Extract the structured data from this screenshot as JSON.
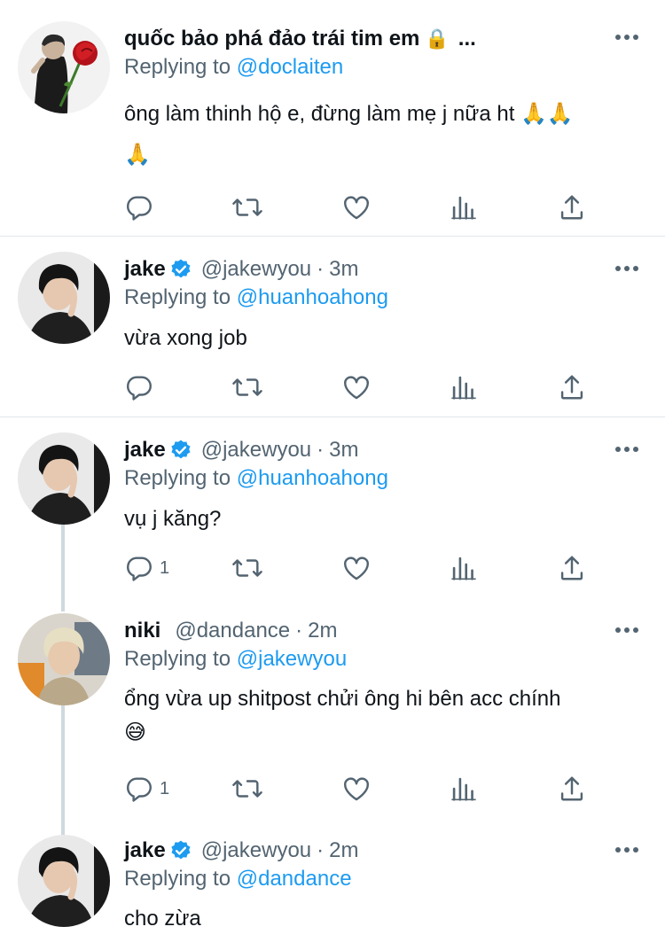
{
  "tweets": [
    {
      "name": "quốc bảo phá đảo trái tim em",
      "lock": "🔒",
      "ellipsis": "...",
      "handle": "",
      "time": "",
      "replying_prefix": "Replying to",
      "replying_to": "@doclaiten",
      "text_line1": "ông làm thinh hộ e, đừng làm mẹ j nữa ht 🙏🙏",
      "text_line2": "🙏",
      "reply_count": "",
      "verified": false
    },
    {
      "name": "jake",
      "handle": "@jakewyou",
      "dot": "·",
      "time": "3m",
      "replying_prefix": "Replying to",
      "replying_to": "@huanhoahong",
      "text_line1": "vừa xong job",
      "reply_count": "",
      "verified": true
    },
    {
      "name": "jake",
      "handle": "@jakewyou",
      "dot": "·",
      "time": "3m",
      "replying_prefix": "Replying to",
      "replying_to": "@huanhoahong",
      "text_line1": "vụ j kăng?",
      "reply_count": "1",
      "verified": true
    },
    {
      "name": "niki",
      "handle": "@dandance",
      "dot": "·",
      "time": "2m",
      "replying_prefix": "Replying to",
      "replying_to": "@jakewyou",
      "text_line1": "ổng vừa up shitpost chửi ông hi bên acc chính",
      "text_line2": "😅",
      "reply_count": "1",
      "verified": false
    },
    {
      "name": "jake",
      "handle": "@jakewyou",
      "dot": "·",
      "time": "2m",
      "replying_prefix": "Replying to",
      "replying_to": "@dandance",
      "text_line1": "cho zừa",
      "verified": true
    }
  ],
  "colors": {
    "accent": "#1d9bf0",
    "secondary_text": "#536471",
    "primary_text": "#0f1419",
    "thread_line": "#cfd9de"
  },
  "icons": [
    "reply-icon",
    "retweet-icon",
    "like-icon",
    "views-icon",
    "share-icon",
    "more-icon",
    "verified-badge-icon"
  ]
}
